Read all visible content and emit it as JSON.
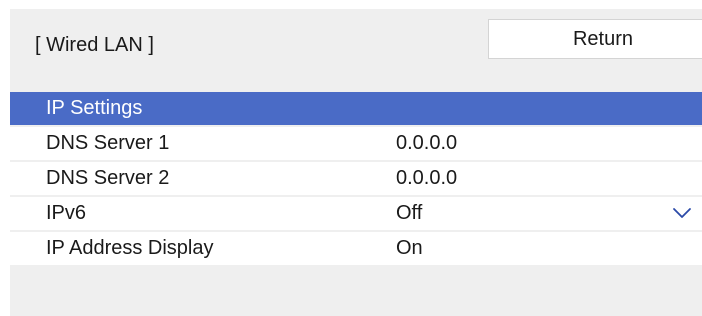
{
  "panel": {
    "title": "[ Wired LAN ]"
  },
  "return_button": {
    "label": "Return"
  },
  "menu": {
    "rows": [
      {
        "label": "IP Settings",
        "value": ""
      },
      {
        "label": "DNS Server 1",
        "value": "0.0.0.0"
      },
      {
        "label": "DNS Server 2",
        "value": "0.0.0.0"
      },
      {
        "label": "IPv6",
        "value": "Off"
      },
      {
        "label": "IP Address Display",
        "value": "On"
      }
    ],
    "selected_row": "IP Settings"
  },
  "icons": {
    "dropdown": "chevron-down-icon"
  },
  "colors": {
    "selection": "#4a6bc6",
    "panel_background": "#efefef",
    "row_background": "#ffffff",
    "dropdown_chevron": "#2b4aa8"
  }
}
